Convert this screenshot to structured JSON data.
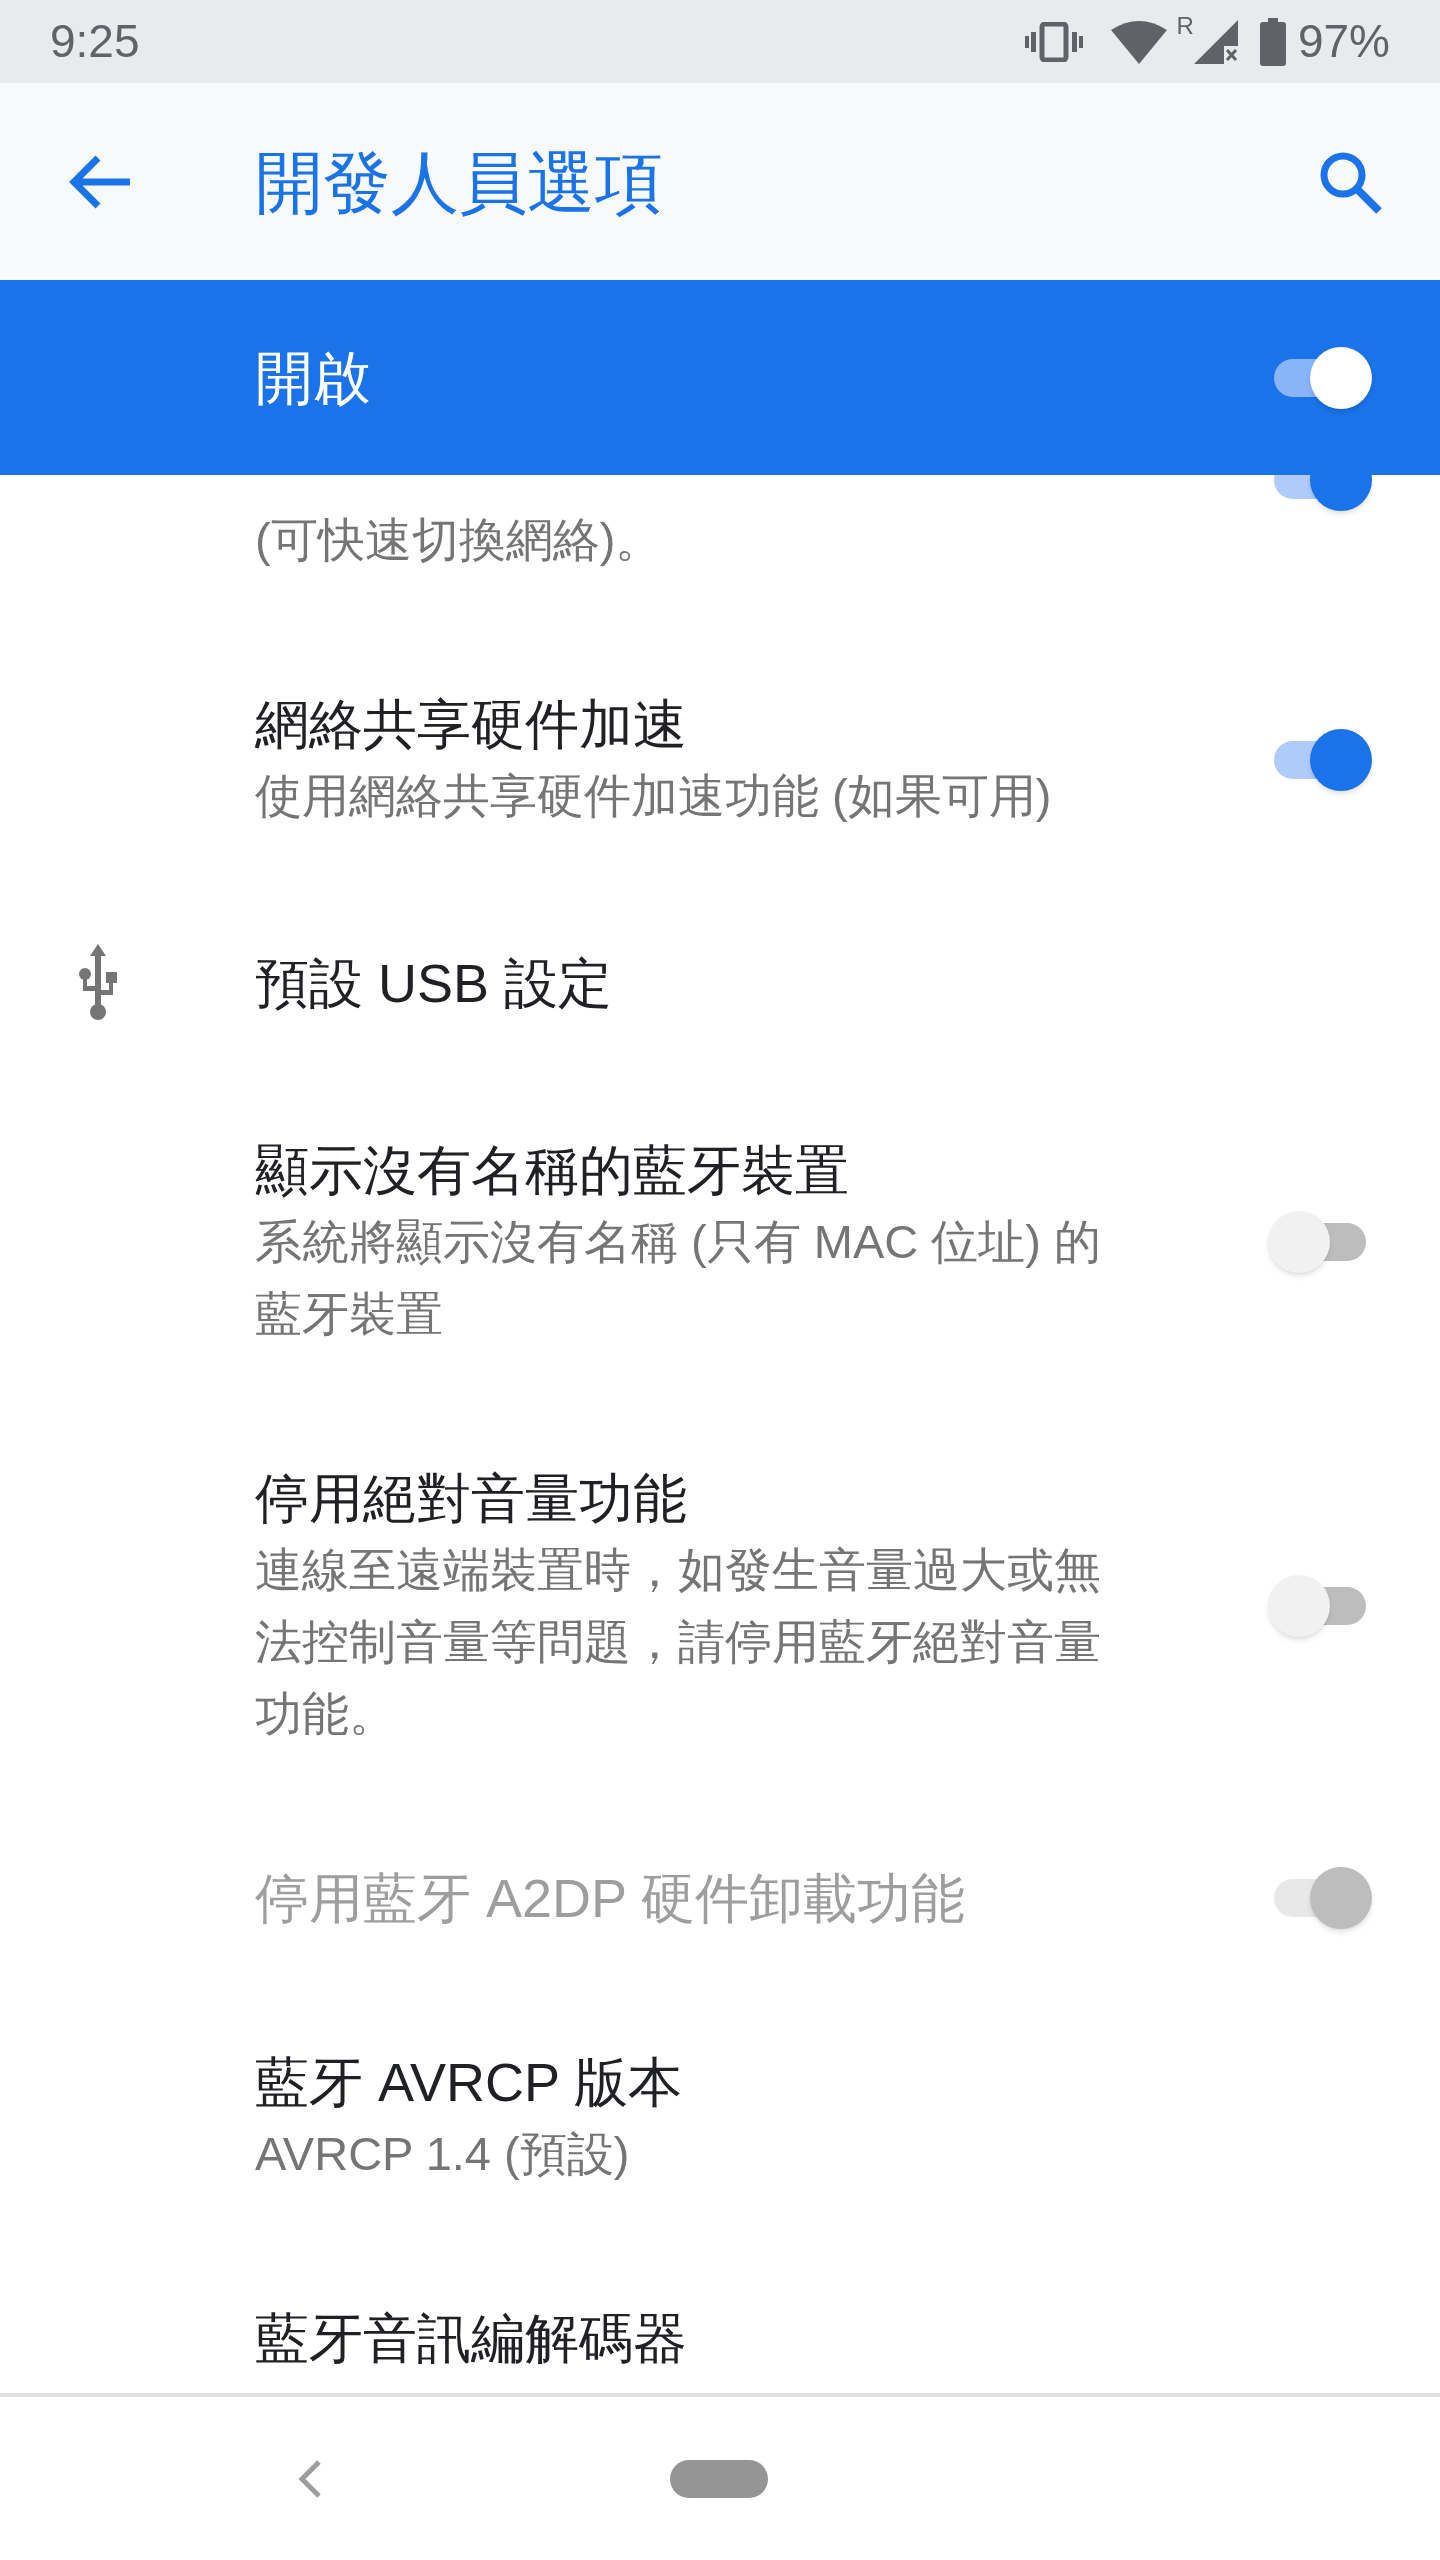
{
  "status_bar": {
    "time": "9:25",
    "roaming": "R",
    "battery": "97%"
  },
  "app_bar": {
    "title": "開發人員選項"
  },
  "master_switch": {
    "label": "開啟",
    "on": true
  },
  "settings": [
    {
      "kind": "toggle",
      "summary": "(可快速切換網絡)。",
      "on": true
    },
    {
      "kind": "toggle",
      "title": "網絡共享硬件加速",
      "summary": "使用網絡共享硬件加速功能 (如果可用)",
      "on": true,
      "disabled": false
    },
    {
      "kind": "icon_link",
      "title": "預設 USB 設定"
    },
    {
      "kind": "toggle",
      "title": "顯示沒有名稱的藍牙裝置",
      "summary": "系統將顯示沒有名稱 (只有 MAC 位址) 的藍牙裝置",
      "on": false,
      "disabled": false
    },
    {
      "kind": "toggle",
      "title": "停用絕對音量功能",
      "summary": "連線至遠端裝置時，如發生音量過大或無法控制音量等問題，請停用藍牙絕對音量功能。",
      "on": false,
      "disabled": false
    },
    {
      "kind": "toggle",
      "title": "停用藍牙 A2DP 硬件卸載功能",
      "on": true,
      "disabled": true
    },
    {
      "kind": "link",
      "title": "藍牙 AVRCP 版本",
      "summary": "AVRCP 1.4 (預設)"
    },
    {
      "kind": "link",
      "title": "藍牙音訊編解碼器"
    }
  ]
}
